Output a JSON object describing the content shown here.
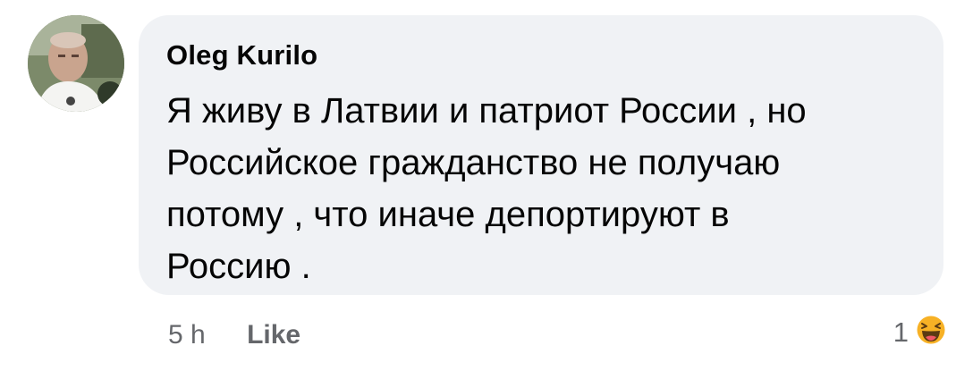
{
  "comment": {
    "author": "Oleg  Kurilo",
    "text_lines": [
      "Я живу в Латвии и патриот России , но",
      "Российское гражданство не получаю",
      "потому , что иначе депортируют в",
      "Россию ."
    ],
    "timestamp": "5 h",
    "like_label": "Like",
    "reaction_count": "1",
    "reaction_icon": "haha-icon"
  },
  "colors": {
    "bubble_bg": "#f0f2f5",
    "text": "#050505",
    "meta_text": "#65676b",
    "haha_face": "#f7b125"
  }
}
